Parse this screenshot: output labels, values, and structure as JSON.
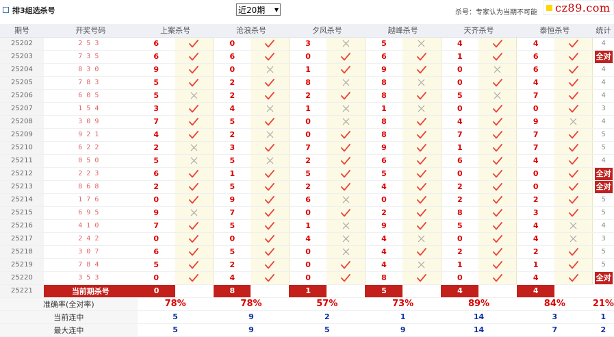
{
  "header": {
    "title": "排3组选杀号",
    "period_select": "近20期",
    "note": "杀号：专家认为当期不可能",
    "logo_text": "cz89.com"
  },
  "columns": [
    "期号",
    "开奖号码",
    "上案杀号",
    "沧浪杀号",
    "夕风杀号",
    "越峰杀号",
    "天齐杀号",
    "泰恒杀号",
    "统计"
  ],
  "rows": [
    {
      "period": "25202",
      "draw": "253",
      "experts": [
        {
          "n": "6",
          "ok": true
        },
        {
          "n": "0",
          "ok": true
        },
        {
          "n": "3",
          "ok": false
        },
        {
          "n": "5",
          "ok": false
        },
        {
          "n": "4",
          "ok": true
        },
        {
          "n": "4",
          "ok": true
        }
      ],
      "stat": "4"
    },
    {
      "period": "25203",
      "draw": "735",
      "experts": [
        {
          "n": "6",
          "ok": true
        },
        {
          "n": "6",
          "ok": true
        },
        {
          "n": "0",
          "ok": true
        },
        {
          "n": "6",
          "ok": true
        },
        {
          "n": "1",
          "ok": true
        },
        {
          "n": "6",
          "ok": true
        }
      ],
      "stat": "全对"
    },
    {
      "period": "25204",
      "draw": "830",
      "experts": [
        {
          "n": "9",
          "ok": true
        },
        {
          "n": "0",
          "ok": false
        },
        {
          "n": "1",
          "ok": true
        },
        {
          "n": "9",
          "ok": true
        },
        {
          "n": "0",
          "ok": false
        },
        {
          "n": "6",
          "ok": true
        }
      ],
      "stat": "4"
    },
    {
      "period": "25205",
      "draw": "783",
      "experts": [
        {
          "n": "5",
          "ok": true
        },
        {
          "n": "2",
          "ok": true
        },
        {
          "n": "8",
          "ok": false
        },
        {
          "n": "8",
          "ok": false
        },
        {
          "n": "0",
          "ok": true
        },
        {
          "n": "4",
          "ok": true
        }
      ],
      "stat": "4"
    },
    {
      "period": "25206",
      "draw": "605",
      "experts": [
        {
          "n": "5",
          "ok": false
        },
        {
          "n": "2",
          "ok": true
        },
        {
          "n": "2",
          "ok": true
        },
        {
          "n": "8",
          "ok": true
        },
        {
          "n": "5",
          "ok": false
        },
        {
          "n": "7",
          "ok": true
        }
      ],
      "stat": "4"
    },
    {
      "period": "25207",
      "draw": "154",
      "experts": [
        {
          "n": "3",
          "ok": true
        },
        {
          "n": "4",
          "ok": false
        },
        {
          "n": "1",
          "ok": false
        },
        {
          "n": "1",
          "ok": false
        },
        {
          "n": "0",
          "ok": true
        },
        {
          "n": "0",
          "ok": true
        }
      ],
      "stat": "3"
    },
    {
      "period": "25208",
      "draw": "309",
      "experts": [
        {
          "n": "7",
          "ok": true
        },
        {
          "n": "5",
          "ok": true
        },
        {
          "n": "0",
          "ok": false
        },
        {
          "n": "8",
          "ok": true
        },
        {
          "n": "4",
          "ok": true
        },
        {
          "n": "9",
          "ok": false
        }
      ],
      "stat": "4"
    },
    {
      "period": "25209",
      "draw": "921",
      "experts": [
        {
          "n": "4",
          "ok": true
        },
        {
          "n": "2",
          "ok": false
        },
        {
          "n": "0",
          "ok": true
        },
        {
          "n": "8",
          "ok": true
        },
        {
          "n": "7",
          "ok": true
        },
        {
          "n": "7",
          "ok": true
        }
      ],
      "stat": "5"
    },
    {
      "period": "25210",
      "draw": "622",
      "experts": [
        {
          "n": "2",
          "ok": false
        },
        {
          "n": "3",
          "ok": true
        },
        {
          "n": "7",
          "ok": true
        },
        {
          "n": "9",
          "ok": true
        },
        {
          "n": "1",
          "ok": true
        },
        {
          "n": "7",
          "ok": true
        }
      ],
      "stat": "5"
    },
    {
      "period": "25211",
      "draw": "050",
      "experts": [
        {
          "n": "5",
          "ok": false
        },
        {
          "n": "5",
          "ok": false
        },
        {
          "n": "2",
          "ok": true
        },
        {
          "n": "6",
          "ok": true
        },
        {
          "n": "6",
          "ok": true
        },
        {
          "n": "4",
          "ok": true
        }
      ],
      "stat": "4"
    },
    {
      "period": "25212",
      "draw": "223",
      "experts": [
        {
          "n": "6",
          "ok": true
        },
        {
          "n": "1",
          "ok": true
        },
        {
          "n": "5",
          "ok": true
        },
        {
          "n": "5",
          "ok": true
        },
        {
          "n": "0",
          "ok": true
        },
        {
          "n": "0",
          "ok": true
        }
      ],
      "stat": "全对"
    },
    {
      "period": "25213",
      "draw": "868",
      "experts": [
        {
          "n": "2",
          "ok": true
        },
        {
          "n": "5",
          "ok": true
        },
        {
          "n": "2",
          "ok": true
        },
        {
          "n": "4",
          "ok": true
        },
        {
          "n": "2",
          "ok": true
        },
        {
          "n": "0",
          "ok": true
        }
      ],
      "stat": "全对"
    },
    {
      "period": "25214",
      "draw": "176",
      "experts": [
        {
          "n": "0",
          "ok": true
        },
        {
          "n": "9",
          "ok": true
        },
        {
          "n": "6",
          "ok": false
        },
        {
          "n": "0",
          "ok": true
        },
        {
          "n": "2",
          "ok": true
        },
        {
          "n": "2",
          "ok": true
        }
      ],
      "stat": "5"
    },
    {
      "period": "25215",
      "draw": "695",
      "experts": [
        {
          "n": "9",
          "ok": false
        },
        {
          "n": "7",
          "ok": true
        },
        {
          "n": "0",
          "ok": true
        },
        {
          "n": "2",
          "ok": true
        },
        {
          "n": "8",
          "ok": true
        },
        {
          "n": "3",
          "ok": true
        }
      ],
      "stat": "5"
    },
    {
      "period": "25216",
      "draw": "410",
      "experts": [
        {
          "n": "7",
          "ok": true
        },
        {
          "n": "5",
          "ok": true
        },
        {
          "n": "1",
          "ok": false
        },
        {
          "n": "9",
          "ok": true
        },
        {
          "n": "5",
          "ok": true
        },
        {
          "n": "4",
          "ok": false
        }
      ],
      "stat": "4"
    },
    {
      "period": "25217",
      "draw": "242",
      "experts": [
        {
          "n": "0",
          "ok": true
        },
        {
          "n": "0",
          "ok": true
        },
        {
          "n": "4",
          "ok": false
        },
        {
          "n": "4",
          "ok": false
        },
        {
          "n": "0",
          "ok": true
        },
        {
          "n": "4",
          "ok": false
        }
      ],
      "stat": "3"
    },
    {
      "period": "25218",
      "draw": "307",
      "experts": [
        {
          "n": "6",
          "ok": true
        },
        {
          "n": "5",
          "ok": true
        },
        {
          "n": "0",
          "ok": false
        },
        {
          "n": "4",
          "ok": true
        },
        {
          "n": "2",
          "ok": true
        },
        {
          "n": "2",
          "ok": true
        }
      ],
      "stat": "5"
    },
    {
      "period": "25219",
      "draw": "784",
      "experts": [
        {
          "n": "5",
          "ok": true
        },
        {
          "n": "2",
          "ok": true
        },
        {
          "n": "0",
          "ok": true
        },
        {
          "n": "4",
          "ok": false
        },
        {
          "n": "1",
          "ok": true
        },
        {
          "n": "1",
          "ok": true
        }
      ],
      "stat": "5"
    },
    {
      "period": "25220",
      "draw": "353",
      "experts": [
        {
          "n": "0",
          "ok": true
        },
        {
          "n": "4",
          "ok": true
        },
        {
          "n": "0",
          "ok": true
        },
        {
          "n": "8",
          "ok": true
        },
        {
          "n": "0",
          "ok": true
        },
        {
          "n": "4",
          "ok": true
        }
      ],
      "stat": "全对"
    }
  ],
  "current": {
    "period": "25221",
    "label": "当前期杀号",
    "values": [
      "0",
      "8",
      "1",
      "5",
      "4",
      "4"
    ]
  },
  "summary": [
    {
      "label": "准确率(全对率)",
      "type": "pct",
      "values": [
        "78%",
        "78%",
        "57%",
        "73%",
        "89%",
        "84%"
      ],
      "stat": "21%"
    },
    {
      "label": "当前连中",
      "type": "streak",
      "values": [
        "5",
        "9",
        "2",
        "1",
        "14",
        "3"
      ],
      "stat": "1"
    },
    {
      "label": "最大连中",
      "type": "streak",
      "values": [
        "5",
        "9",
        "5",
        "9",
        "14",
        "7"
      ],
      "stat": "2"
    }
  ]
}
